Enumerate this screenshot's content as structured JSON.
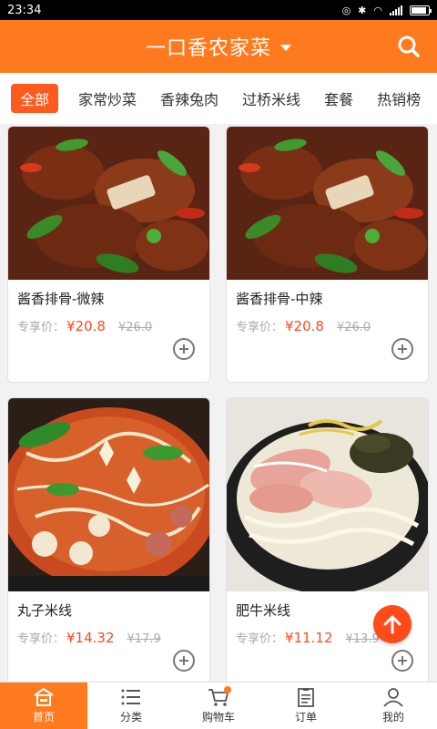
{
  "status": {
    "time": "23:34"
  },
  "header": {
    "title": "一口香农家菜"
  },
  "tabs": [
    "全部",
    "家常炒菜",
    "香辣兔肉",
    "过桥米线",
    "套餐",
    "热销榜"
  ],
  "products": [
    {
      "name": "酱香排骨-微辣",
      "price_label": "专享价：",
      "price": "¥20.8",
      "old_price": "¥26.0"
    },
    {
      "name": "酱香排骨-中辣",
      "price_label": "专享价：",
      "price": "¥20.8",
      "old_price": "¥26.0"
    },
    {
      "name": "丸子米线",
      "price_label": "专享价：",
      "price": "¥14.32",
      "old_price": "¥17.9"
    },
    {
      "name": "肥牛米线",
      "price_label": "专享价：",
      "price": "¥11.12",
      "old_price": "¥13.9"
    }
  ],
  "nav": [
    {
      "label": "首页"
    },
    {
      "label": "分类"
    },
    {
      "label": "购物车"
    },
    {
      "label": "订单"
    },
    {
      "label": "我的"
    }
  ],
  "colors": {
    "primary": "#ff7a1e",
    "price": "#ff4a1a"
  }
}
